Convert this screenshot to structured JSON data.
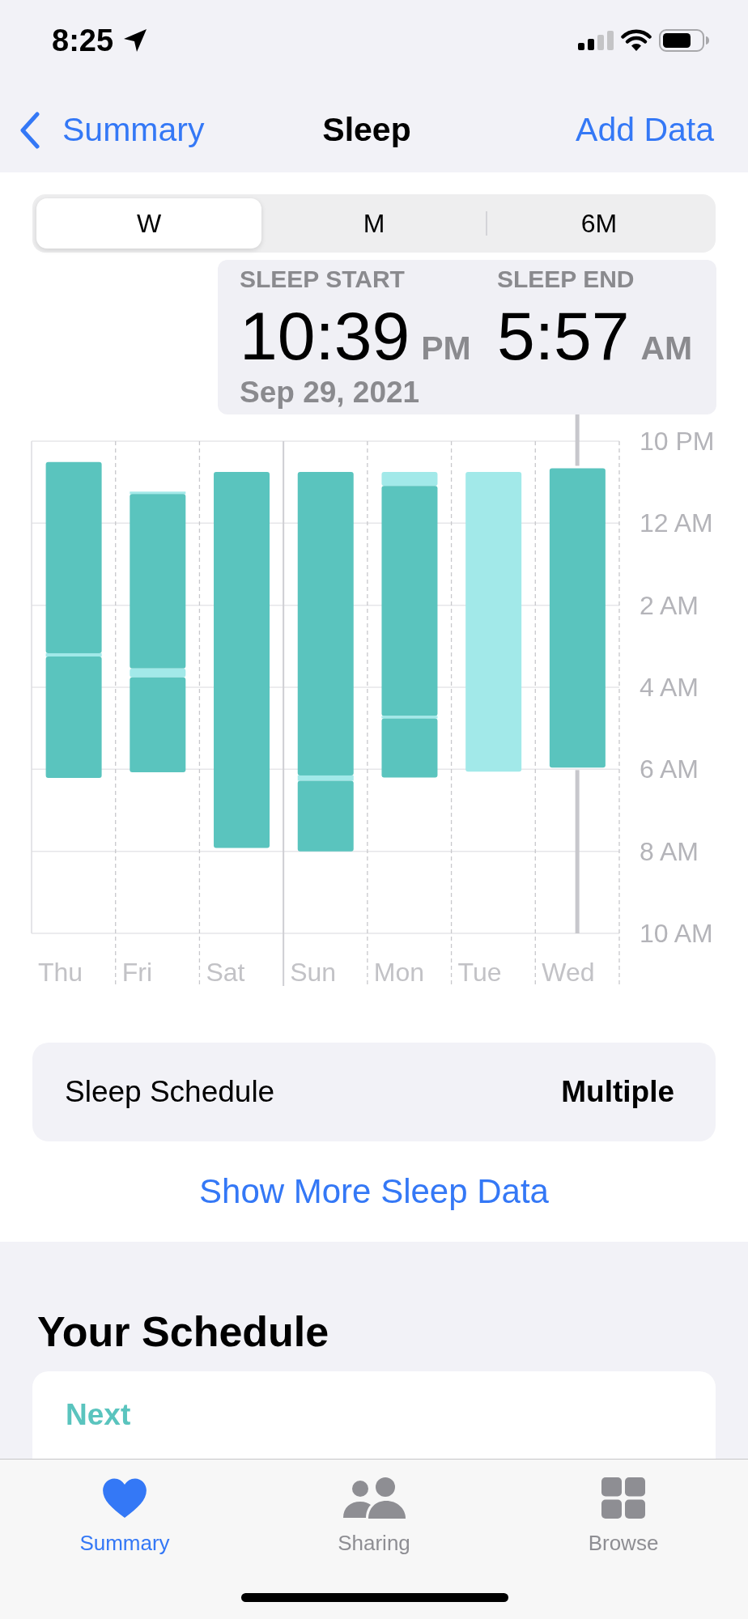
{
  "status_bar": {
    "time": "8:25"
  },
  "nav_bar": {
    "back_label": "Summary",
    "title": "Sleep",
    "action_label": "Add Data"
  },
  "segments": [
    {
      "label": "W",
      "selected": true
    },
    {
      "label": "M",
      "selected": false
    },
    {
      "label": "6M",
      "selected": false
    }
  ],
  "selection_info": {
    "start_label": "SLEEP START",
    "start_time": "10:39",
    "start_period": "PM",
    "end_label": "SLEEP END",
    "end_time": "5:57",
    "end_period": "AM",
    "date": "Sep 29, 2021"
  },
  "chart": {
    "y_labels": [
      "10 PM",
      "12 AM",
      "2 AM",
      "4 AM",
      "6 AM",
      "8 AM",
      "10 AM"
    ],
    "days": [
      {
        "label": "Thu",
        "selected": false,
        "week_start": false
      },
      {
        "label": "Fri",
        "selected": false,
        "week_start": false
      },
      {
        "label": "Sat",
        "selected": false,
        "week_start": false
      },
      {
        "label": "Sun",
        "selected": false,
        "week_start": true
      },
      {
        "label": "Mon",
        "selected": false,
        "week_start": false
      },
      {
        "label": "Tue",
        "selected": false,
        "week_start": false
      },
      {
        "label": "Wed",
        "selected": true,
        "week_start": false
      }
    ]
  },
  "sleep_schedule": {
    "label": "Sleep Schedule",
    "value": "Multiple"
  },
  "show_more_link": "Show More Sleep Data",
  "your_schedule": {
    "title": "Your Schedule",
    "next_label": "Next"
  },
  "tab_bar": [
    {
      "kind": "summary",
      "label": "Summary",
      "selected": true
    },
    {
      "kind": "sharing",
      "label": "Sharing",
      "selected": false
    },
    {
      "kind": "browse",
      "label": "Browse",
      "selected": false
    }
  ]
}
